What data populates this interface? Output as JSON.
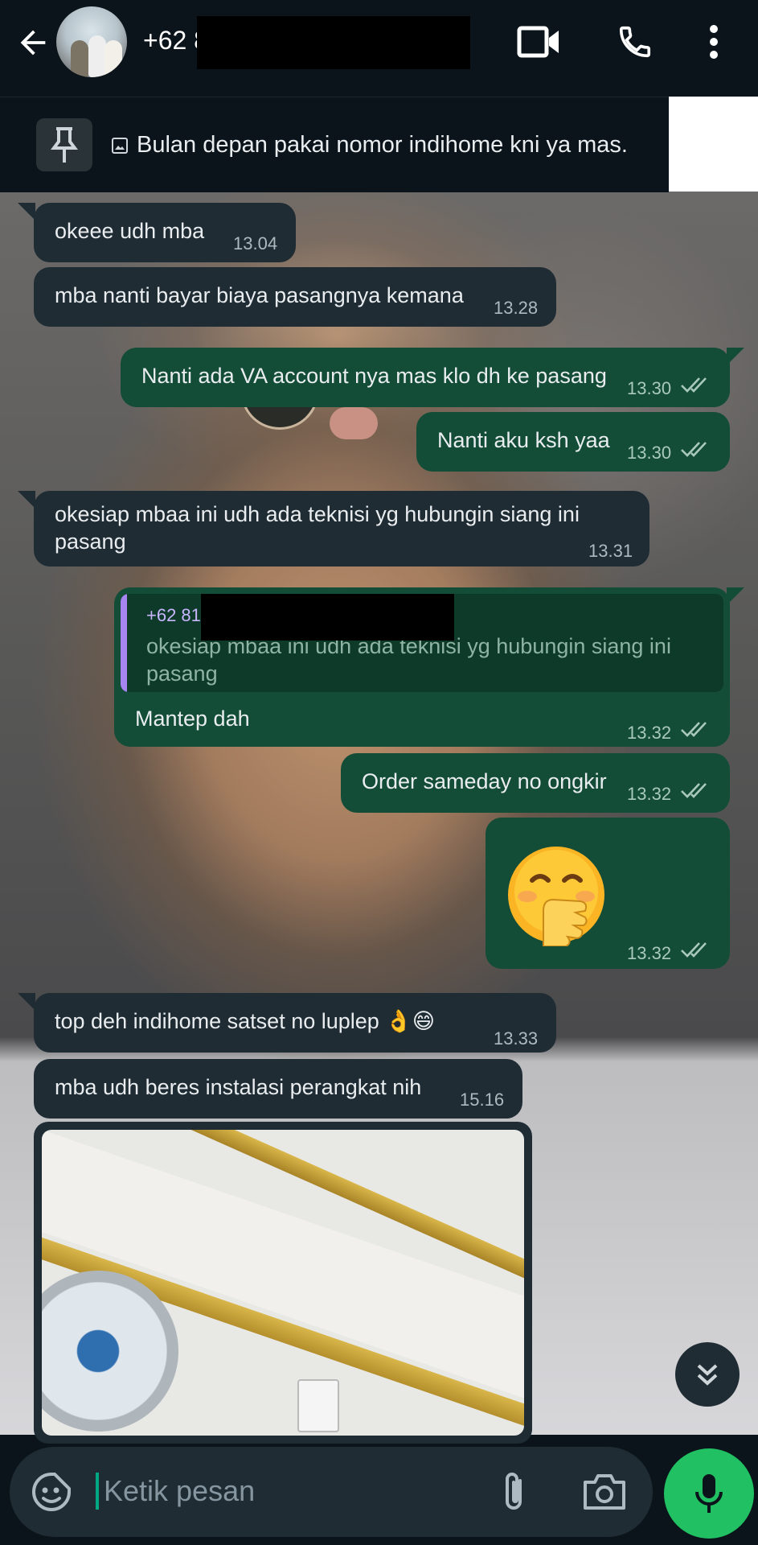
{
  "header": {
    "contact_name": "+62 8",
    "icons": [
      "back-arrow-icon",
      "video-call-icon",
      "voice-call-icon",
      "more-vert-icon"
    ]
  },
  "pinned": {
    "text": "Bulan depan pakai nomor indihome kni ya mas."
  },
  "messages": [
    {
      "dir": "in",
      "text": "okeee udh mba",
      "time": "13.04"
    },
    {
      "dir": "in",
      "text": "mba nanti bayar biaya pasangnya kemana",
      "time": "13.28"
    },
    {
      "dir": "out",
      "text": "Nanti ada VA account nya mas klo dh ke pasang",
      "time": "13.30"
    },
    {
      "dir": "out",
      "text": "Nanti aku ksh yaa",
      "time": "13.30"
    },
    {
      "dir": "in",
      "text_line1": "okesiap mbaa ini udh ada teknisi yg hubungin siang ini",
      "text_line2": "pasang",
      "time": "13.31"
    },
    {
      "dir": "out",
      "quote_name": "+62 81",
      "quote_line1": "okesiap mbaa ini udh ada teknisi yg hubungin siang ini",
      "quote_line2": "pasang",
      "text": "Mantep dah",
      "time": "13.32"
    },
    {
      "dir": "out",
      "text": "Order sameday no ongkir",
      "time": "13.32"
    },
    {
      "dir": "out",
      "emoji": "face-with-hand-over-mouth",
      "time": "13.32"
    },
    {
      "dir": "in",
      "text": "top deh indihome satset no luplep 👌😄",
      "time": "13.33"
    },
    {
      "dir": "in",
      "text": "mba udh beres instalasi perangkat nih",
      "time": "15.16"
    }
  ],
  "input": {
    "placeholder": "Ketik pesan"
  },
  "colors": {
    "incoming_bubble": "#1f2c34",
    "outgoing_bubble": "#144d37",
    "accent": "#21c063"
  }
}
